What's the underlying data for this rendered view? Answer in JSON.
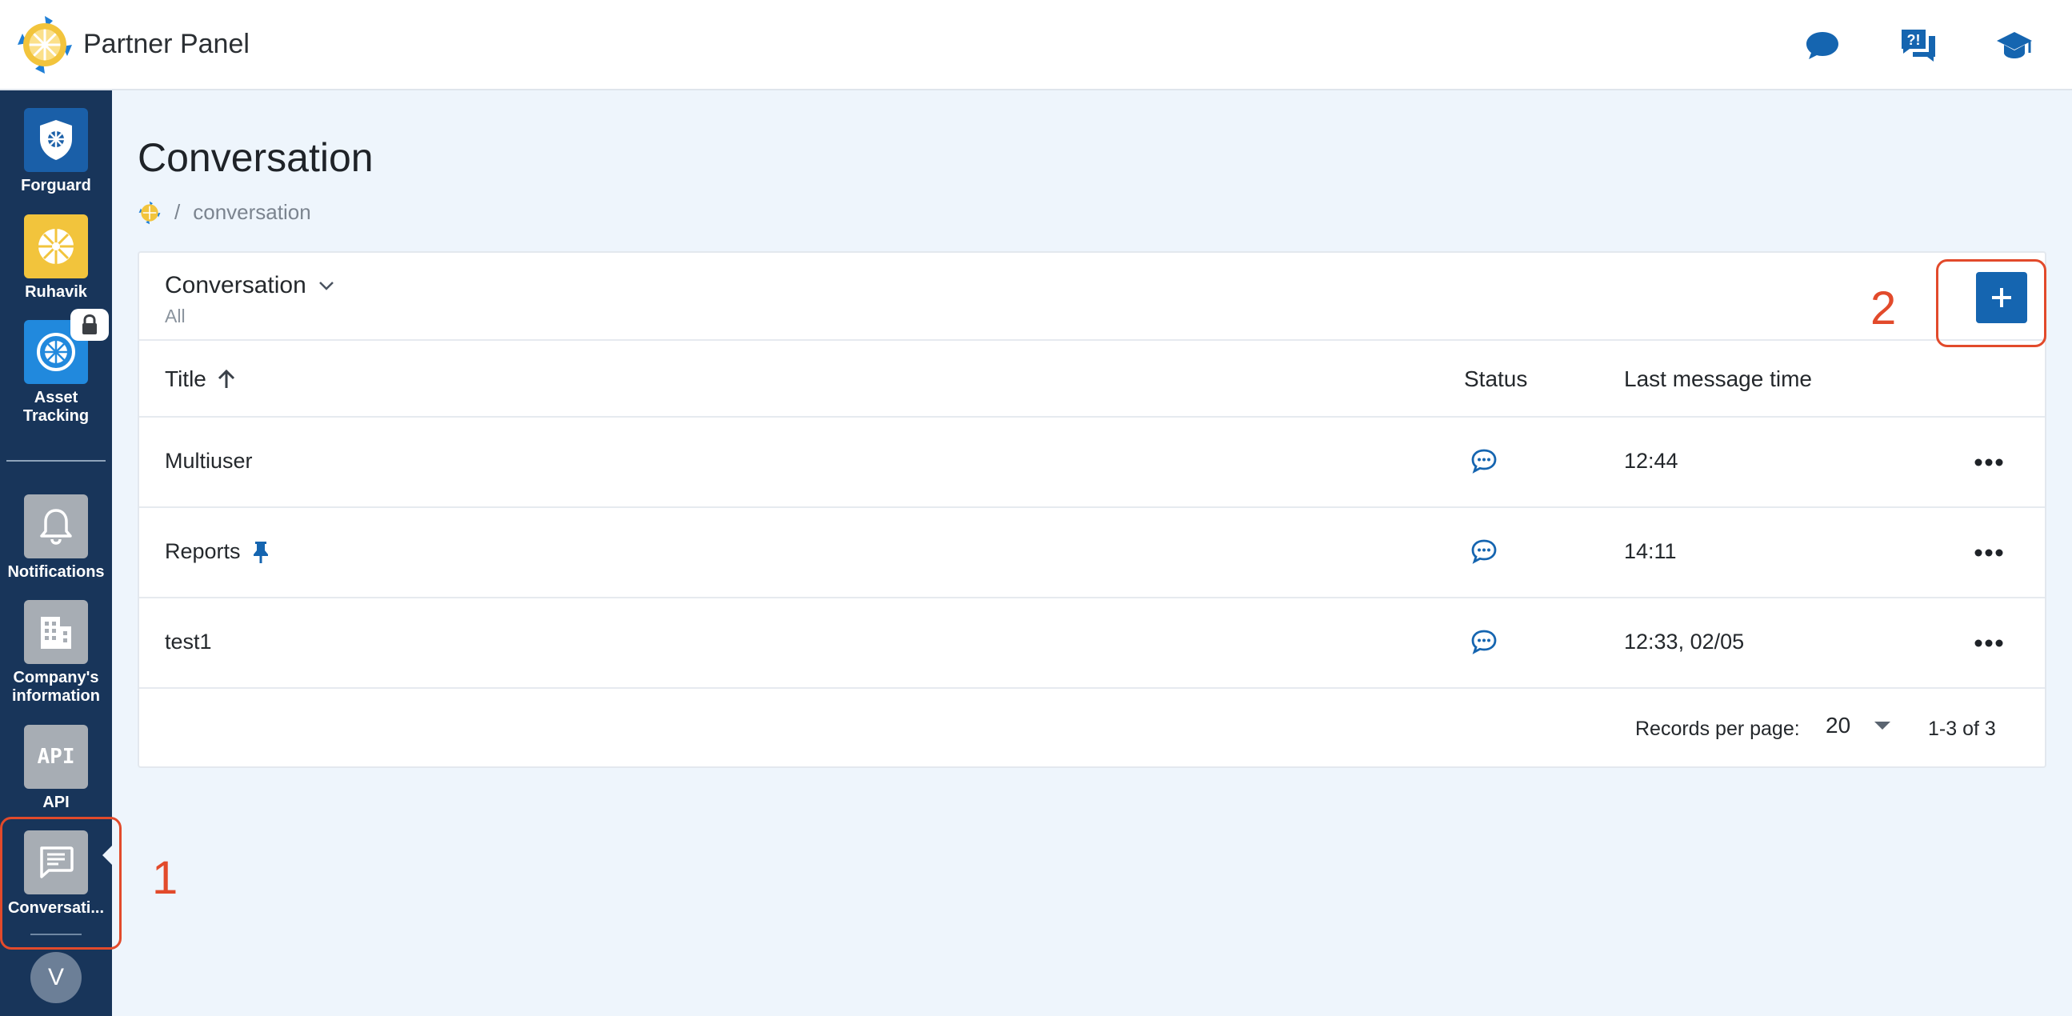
{
  "app": {
    "title": "Partner Panel"
  },
  "top_actions": [
    {
      "icon": "chat-bubble-icon"
    },
    {
      "icon": "help-chat-icon"
    },
    {
      "icon": "graduation-cap-icon"
    }
  ],
  "sidebar": {
    "items": [
      {
        "label": "Forguard",
        "icon": "shield-icon",
        "color": "#1a5fa8"
      },
      {
        "label": "Ruhavik",
        "icon": "ruhavik-icon",
        "color": "#f2c43c"
      },
      {
        "label_line1": "Asset",
        "label_line2": "Tracking",
        "icon": "asset-tracking-icon",
        "color": "#2189dd",
        "locked": true
      },
      {
        "label": "Notifications",
        "icon": "bell-icon",
        "color": "#a7adb4"
      },
      {
        "label_line1": "Company's",
        "label_line2": "information",
        "icon": "building-icon",
        "color": "#a7adb4"
      },
      {
        "label": "API",
        "icon": "api-icon",
        "color": "#a7adb4",
        "icon_text": "API"
      },
      {
        "label": "Conversati...",
        "icon": "conversation-icon",
        "color": "#a7adb4",
        "active": true
      }
    ],
    "avatar_initial": "V"
  },
  "page": {
    "title": "Conversation",
    "breadcrumb": {
      "separator": "/",
      "current": "conversation"
    }
  },
  "card": {
    "title": "Conversation",
    "subtitle": "All",
    "columns": {
      "title": "Title",
      "status": "Status",
      "last_message_time": "Last message time"
    },
    "rows": [
      {
        "title": "Multiuser",
        "pinned": false,
        "last_message_time": "12:44"
      },
      {
        "title": "Reports",
        "pinned": true,
        "last_message_time": "14:11"
      },
      {
        "title": "test1",
        "pinned": false,
        "last_message_time": "12:33, 02/05"
      }
    ],
    "footer": {
      "records_per_page_label": "Records per page:",
      "records_per_page_value": "20",
      "range": "1-3 of 3"
    }
  },
  "annotations": {
    "label_1": "1",
    "label_2": "2",
    "color": "#e24a2b"
  },
  "colors": {
    "primary": "#1565b0",
    "sidebar": "#18355a",
    "background": "#eef5fc"
  }
}
